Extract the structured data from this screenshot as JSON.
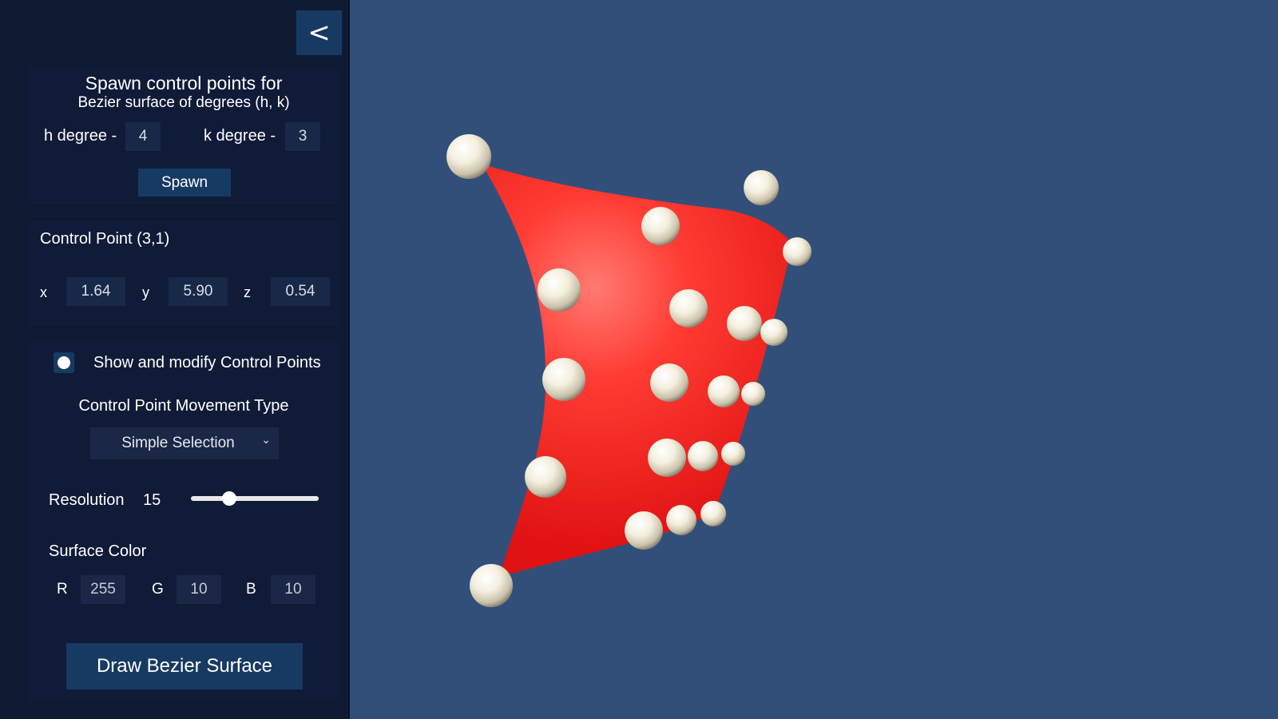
{
  "panel": {
    "collapse_label": "<",
    "spawn": {
      "title": "Spawn control points for",
      "subtitle": "Bezier surface of degrees (h, k)",
      "h_label": "h degree -",
      "h_value": "4",
      "k_label": "k degree -",
      "k_value": "3",
      "button_label": "Spawn"
    },
    "control_point": {
      "title": "Control Point (3,1)",
      "x_label": "x",
      "x_value": "1.64",
      "y_label": "y",
      "y_value": "5.90",
      "z_label": "z",
      "z_value": "0.54"
    },
    "settings": {
      "show_points_label": "Show and modify Control Points",
      "show_points_checked": true,
      "movement_label": "Control Point Movement Type",
      "movement_value": "Simple Selection",
      "resolution_label": "Resolution",
      "resolution_value": "15",
      "resolution_fraction": 0.3,
      "surface_color_label": "Surface Color",
      "r_label": "R",
      "r_value": "255",
      "g_label": "G",
      "g_value": "10",
      "b_label": "B",
      "b_value": "10",
      "draw_button_label": "Draw Bezier Surface"
    }
  },
  "colors": {
    "viewport_bg": "#324f7a",
    "panel_bg": "#0f1a33",
    "accent": "#173a63",
    "surface": "#ff0a0a",
    "control_point": "#f3eedc"
  },
  "icons": {
    "collapse": "chevron-left-icon",
    "dropdown": "chevron-down-icon"
  }
}
